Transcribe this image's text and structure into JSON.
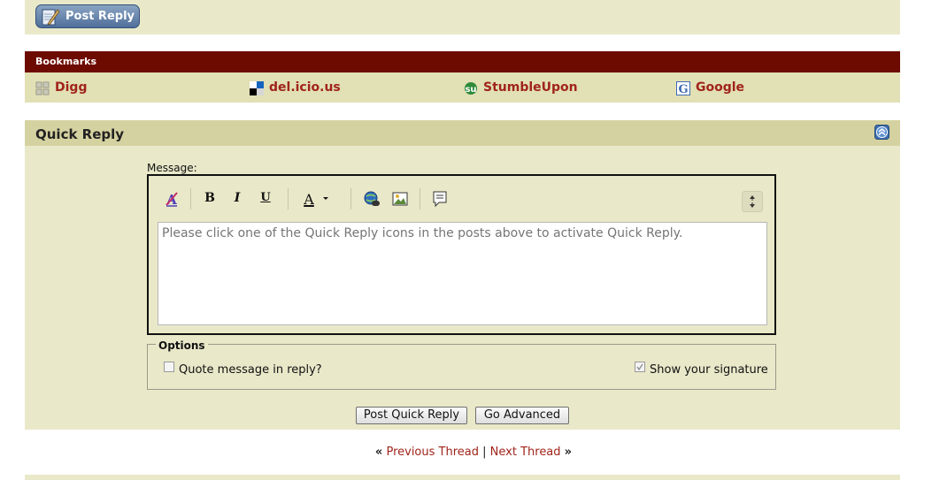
{
  "top": {
    "post_reply_label": "Post Reply"
  },
  "bookmarks": {
    "title": "Bookmarks",
    "items": [
      {
        "label": "Digg",
        "icon": "digg-icon"
      },
      {
        "label": "del.icio.us",
        "icon": "delicious-icon"
      },
      {
        "label": "StumbleUpon",
        "icon": "stumbleupon-icon"
      },
      {
        "label": "Google",
        "icon": "google-icon"
      }
    ]
  },
  "quick_reply": {
    "title": "Quick Reply",
    "message_label": "Message:",
    "placeholder": "Please click one of the Quick Reply icons in the posts above to activate Quick Reply.",
    "toolbar": {
      "bold": "B",
      "italic": "I",
      "underline": "U",
      "font_color": "A",
      "icons": [
        "remove-format-icon",
        "bold-icon",
        "italic-icon",
        "underline-icon",
        "font-color-icon",
        "color-dropdown-icon",
        "insert-link-icon",
        "insert-image-icon",
        "quote-icon",
        "resize-icon"
      ]
    },
    "options": {
      "legend": "Options",
      "quote_label": "Quote message in reply?",
      "quote_checked": false,
      "signature_label": "Show your signature",
      "signature_checked": true
    },
    "post_button": "Post Quick Reply",
    "advanced_button": "Go Advanced"
  },
  "thread_nav": {
    "prev_quote": "«",
    "prev": "Previous Thread",
    "separator": "|",
    "next": "Next Thread",
    "next_quote": "»"
  },
  "colors": {
    "page_bg": "#e9e8c9",
    "bookmarks_header": "#6e0b00",
    "link": "#a0241b",
    "section_header": "#d5d2a1"
  }
}
